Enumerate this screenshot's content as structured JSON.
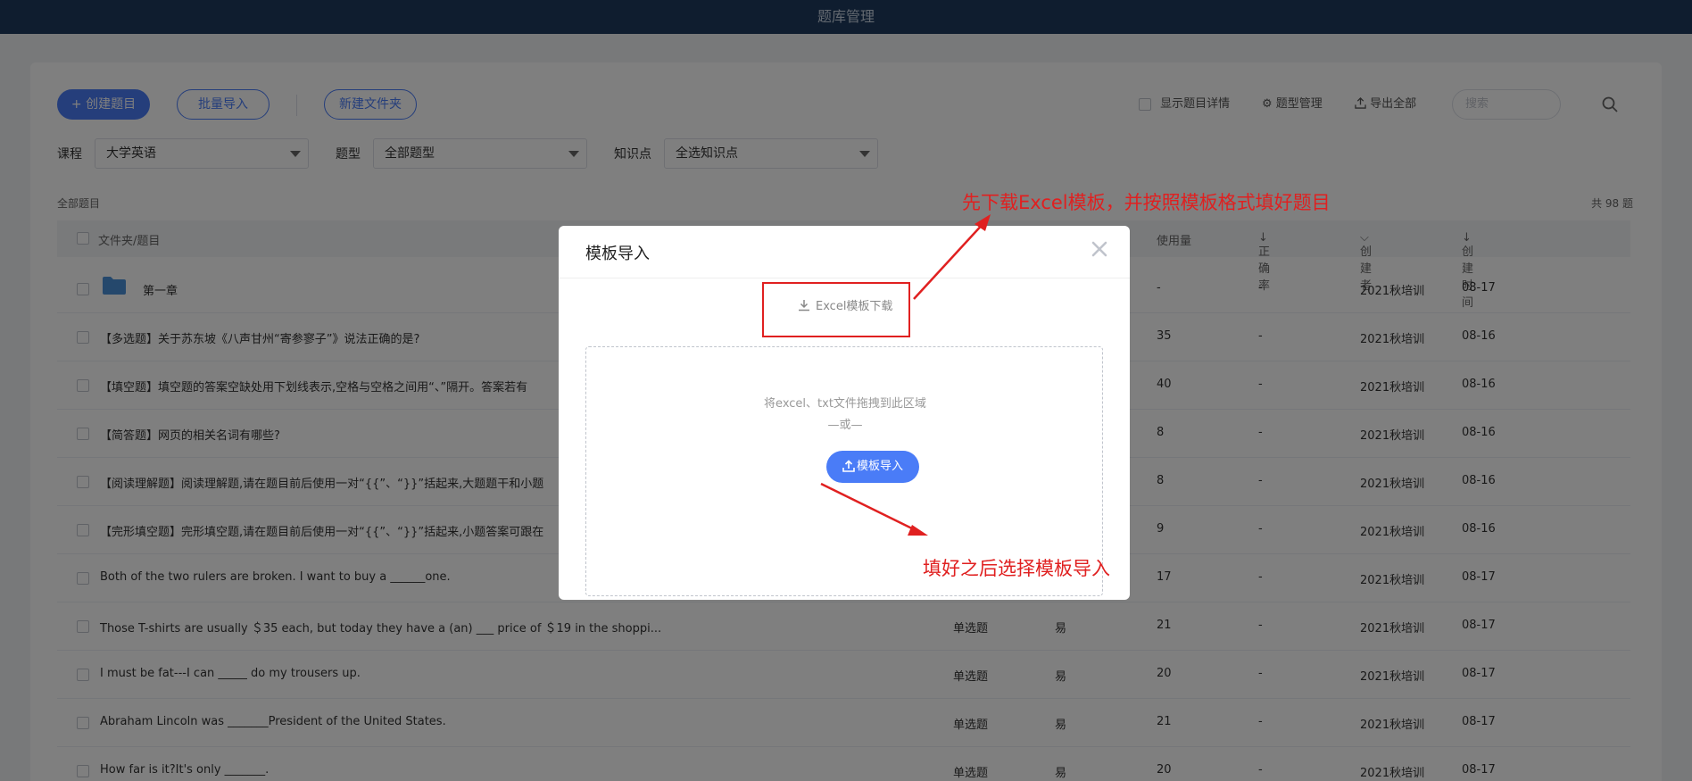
{
  "header": {
    "title": "题库管理"
  },
  "toolbar": {
    "create_label": "创建题目",
    "batch_import_label": "批量导入",
    "new_folder_label": "新建文件夹",
    "show_details_label": "显示题目详情",
    "type_manage_label": "题型管理",
    "export_all_label": "导出全部",
    "search_placeholder": "搜索"
  },
  "filters": {
    "course_label": "课程",
    "course_value": "大学英语",
    "type_label": "题型",
    "type_value": "全部题型",
    "knowledge_label": "知识点",
    "knowledge_value": "全选知识点"
  },
  "list": {
    "section_label": "全部题目",
    "total_label": "共 98 题",
    "columns": {
      "name": "文件夹/题目",
      "usage": "使用量",
      "accuracy": "正确率",
      "creator": "创建者",
      "created_time": "创建时间"
    },
    "rows": [
      {
        "title": "第一章",
        "type": "",
        "difficulty": "",
        "usage": "-",
        "accuracy": "-",
        "creator": "2021秋培训",
        "date": "08-17"
      },
      {
        "title": "【多选题】关于苏东坡《八声甘州“寄参寥子”》说法正确的是?",
        "type": "",
        "difficulty": "",
        "usage": "35",
        "accuracy": "-",
        "creator": "2021秋培训",
        "date": "08-16"
      },
      {
        "title": "【填空题】填空题的答案空缺处用下划线表示,空格与空格之间用“、”隔开。答案若有",
        "type": "",
        "difficulty": "",
        "usage": "40",
        "accuracy": "-",
        "creator": "2021秋培训",
        "date": "08-16"
      },
      {
        "title": "【简答题】网页的相关名词有哪些?",
        "type": "",
        "difficulty": "",
        "usage": "8",
        "accuracy": "-",
        "creator": "2021秋培训",
        "date": "08-16"
      },
      {
        "title": "【阅读理解题】阅读理解题,请在题目前后使用一对“{{”、“}}”括起来,大题题干和小题",
        "type": "",
        "difficulty": "",
        "usage": "8",
        "accuracy": "-",
        "creator": "2021秋培训",
        "date": "08-16"
      },
      {
        "title": "【完形填空题】完形填空题,请在题目前后使用一对“{{”、“}}”括起来,小题答案可跟在",
        "type": "",
        "difficulty": "",
        "usage": "9",
        "accuracy": "-",
        "creator": "2021秋培训",
        "date": "08-16"
      },
      {
        "title": "Both of the two rulers are broken. I want to buy a ______one.",
        "type": "",
        "difficulty": "",
        "usage": "17",
        "accuracy": "-",
        "creator": "2021秋培训",
        "date": "08-17"
      },
      {
        "title": "Those T-shirts are usually ＄35 each, but today they have a (an) ___ price of ＄19 in the shoppi...",
        "type": "单选题",
        "difficulty": "易",
        "usage": "21",
        "accuracy": "-",
        "creator": "2021秋培训",
        "date": "08-17"
      },
      {
        "title": "I must be fat---I can _____ do my trousers up.",
        "type": "单选题",
        "difficulty": "易",
        "usage": "20",
        "accuracy": "-",
        "creator": "2021秋培训",
        "date": "08-17"
      },
      {
        "title": "Abraham Lincoln was _______President of the United States.",
        "type": "单选题",
        "difficulty": "易",
        "usage": "21",
        "accuracy": "-",
        "creator": "2021秋培训",
        "date": "08-17"
      },
      {
        "title": "How far is it?It's only _______.",
        "type": "单选题",
        "difficulty": "易",
        "usage": "20",
        "accuracy": "-",
        "creator": "2021秋培训",
        "date": "08-17"
      }
    ]
  },
  "modal": {
    "title": "模板导入",
    "download_label": "Excel模板下载",
    "drop_hint": "将excel、txt文件拖拽到此区域",
    "or_label": "—或—",
    "upload_label": "模板导入"
  },
  "annotations": {
    "top": "先下载Excel模板，并按照模板格式填好题目",
    "bottom": "填好之后选择模板导入"
  },
  "colors": {
    "accent": "#4a7cf7",
    "header": "#1e3a5f",
    "annotation": "#e02020"
  }
}
